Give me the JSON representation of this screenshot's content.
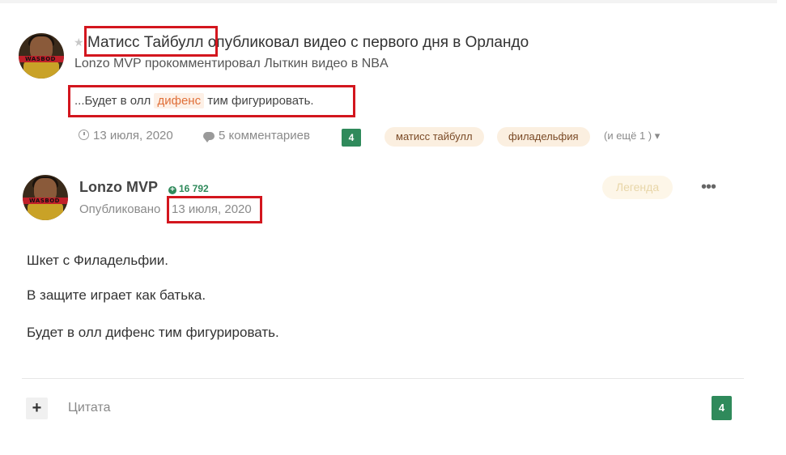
{
  "activity": {
    "author_name": "Матисс Тайбулл",
    "action_text": " опубликовал видео с первого дня в Орландо",
    "subline": "Lonzo MVP прокомментировал Лыткин видео в NBA",
    "snippet_before": "...Будет в олл ",
    "snippet_highlight": "дифенс",
    "snippet_after": " тим фигурировать.",
    "date": "13 июля, 2020",
    "comments": "5 комментариев",
    "count_badge": "4",
    "tags": [
      "матисс тайбулл",
      "филадельфия"
    ],
    "more_tags": "(и ещё 1 )"
  },
  "post": {
    "author": "Lonzo MVP",
    "reputation": "16 792",
    "published_label": "Опубликовано",
    "published_date": "13 июля, 2020",
    "rank": "Легенда",
    "menu_glyph": "•••",
    "paragraphs": [
      "Шкет с Филадельфии.",
      "В защите играет как батька.",
      "Будет в олл дифенс тим фигурировать."
    ]
  },
  "footer": {
    "plus_glyph": "+",
    "quote_label": "Цитата",
    "count_badge": "4"
  },
  "colors": {
    "accent_green": "#2f8a5b",
    "highlight_red_box": "#d3161e",
    "tag_bg": "#fbefe0",
    "tag_text": "#7a4a26"
  },
  "icons": {
    "star": "star-icon",
    "clock": "clock-icon",
    "comment": "comment-icon",
    "reputation": "plus-circle-icon",
    "menu": "ellipsis-icon",
    "dropdown": "caret-down-icon"
  }
}
